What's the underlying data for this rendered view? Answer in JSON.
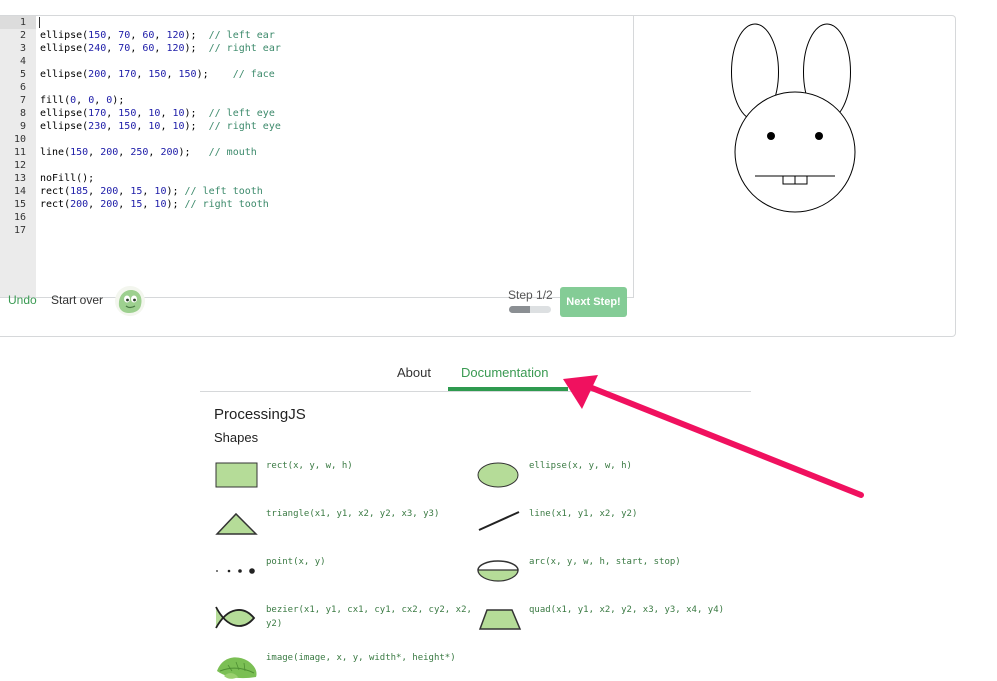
{
  "editor": {
    "line_numbers": [
      "1",
      "2",
      "3",
      "4",
      "5",
      "6",
      "7",
      "8",
      "9",
      "10",
      "11",
      "12",
      "13",
      "14",
      "15",
      "16",
      "17"
    ],
    "code_lines": [
      [],
      [
        {
          "t": "ellipse(",
          "c": ""
        },
        {
          "t": "150",
          "c": "num"
        },
        {
          "t": ", ",
          "c": ""
        },
        {
          "t": "70",
          "c": "num"
        },
        {
          "t": ", ",
          "c": ""
        },
        {
          "t": "60",
          "c": "num"
        },
        {
          "t": ", ",
          "c": ""
        },
        {
          "t": "120",
          "c": "num"
        },
        {
          "t": ");  ",
          "c": ""
        },
        {
          "t": "// left ear",
          "c": "cmt"
        }
      ],
      [
        {
          "t": "ellipse(",
          "c": ""
        },
        {
          "t": "240",
          "c": "num"
        },
        {
          "t": ", ",
          "c": ""
        },
        {
          "t": "70",
          "c": "num"
        },
        {
          "t": ", ",
          "c": ""
        },
        {
          "t": "60",
          "c": "num"
        },
        {
          "t": ", ",
          "c": ""
        },
        {
          "t": "120",
          "c": "num"
        },
        {
          "t": ");  ",
          "c": ""
        },
        {
          "t": "// right ear",
          "c": "cmt"
        }
      ],
      [],
      [
        {
          "t": "ellipse(",
          "c": ""
        },
        {
          "t": "200",
          "c": "num"
        },
        {
          "t": ", ",
          "c": ""
        },
        {
          "t": "170",
          "c": "num"
        },
        {
          "t": ", ",
          "c": ""
        },
        {
          "t": "150",
          "c": "num"
        },
        {
          "t": ", ",
          "c": ""
        },
        {
          "t": "150",
          "c": "num"
        },
        {
          "t": ");    ",
          "c": ""
        },
        {
          "t": "// face",
          "c": "cmt"
        }
      ],
      [],
      [
        {
          "t": "fill(",
          "c": ""
        },
        {
          "t": "0",
          "c": "num"
        },
        {
          "t": ", ",
          "c": ""
        },
        {
          "t": "0",
          "c": "num"
        },
        {
          "t": ", ",
          "c": ""
        },
        {
          "t": "0",
          "c": "num"
        },
        {
          "t": ");",
          "c": ""
        }
      ],
      [
        {
          "t": "ellipse(",
          "c": ""
        },
        {
          "t": "170",
          "c": "num"
        },
        {
          "t": ", ",
          "c": ""
        },
        {
          "t": "150",
          "c": "num"
        },
        {
          "t": ", ",
          "c": ""
        },
        {
          "t": "10",
          "c": "num"
        },
        {
          "t": ", ",
          "c": ""
        },
        {
          "t": "10",
          "c": "num"
        },
        {
          "t": ");  ",
          "c": ""
        },
        {
          "t": "// left eye",
          "c": "cmt"
        }
      ],
      [
        {
          "t": "ellipse(",
          "c": ""
        },
        {
          "t": "230",
          "c": "num"
        },
        {
          "t": ", ",
          "c": ""
        },
        {
          "t": "150",
          "c": "num"
        },
        {
          "t": ", ",
          "c": ""
        },
        {
          "t": "10",
          "c": "num"
        },
        {
          "t": ", ",
          "c": ""
        },
        {
          "t": "10",
          "c": "num"
        },
        {
          "t": ");  ",
          "c": ""
        },
        {
          "t": "// right eye",
          "c": "cmt"
        }
      ],
      [],
      [
        {
          "t": "line(",
          "c": ""
        },
        {
          "t": "150",
          "c": "num"
        },
        {
          "t": ", ",
          "c": ""
        },
        {
          "t": "200",
          "c": "num"
        },
        {
          "t": ", ",
          "c": ""
        },
        {
          "t": "250",
          "c": "num"
        },
        {
          "t": ", ",
          "c": ""
        },
        {
          "t": "200",
          "c": "num"
        },
        {
          "t": ");   ",
          "c": ""
        },
        {
          "t": "// mouth",
          "c": "cmt"
        }
      ],
      [],
      [
        {
          "t": "noFill();",
          "c": ""
        }
      ],
      [
        {
          "t": "rect(",
          "c": ""
        },
        {
          "t": "185",
          "c": "num"
        },
        {
          "t": ", ",
          "c": ""
        },
        {
          "t": "200",
          "c": "num"
        },
        {
          "t": ", ",
          "c": ""
        },
        {
          "t": "15",
          "c": "num"
        },
        {
          "t": ", ",
          "c": ""
        },
        {
          "t": "10",
          "c": "num"
        },
        {
          "t": "); ",
          "c": ""
        },
        {
          "t": "// left tooth",
          "c": "cmt"
        }
      ],
      [
        {
          "t": "rect(",
          "c": ""
        },
        {
          "t": "200",
          "c": "num"
        },
        {
          "t": ", ",
          "c": ""
        },
        {
          "t": "200",
          "c": "num"
        },
        {
          "t": ", ",
          "c": ""
        },
        {
          "t": "15",
          "c": "num"
        },
        {
          "t": ", ",
          "c": ""
        },
        {
          "t": "10",
          "c": "num"
        },
        {
          "t": "); ",
          "c": ""
        },
        {
          "t": "// right tooth",
          "c": "cmt"
        }
      ],
      [],
      []
    ]
  },
  "toolbar": {
    "undo_label": "Undo",
    "start_over_label": "Start over",
    "step_label": "Step 1/2",
    "step_progress": 0.5,
    "next_label": "Next Step!"
  },
  "tabs": {
    "about": "About",
    "documentation": "Documentation"
  },
  "docs": {
    "title": "ProcessingJS",
    "section": "Shapes",
    "functions": {
      "rect": "rect(x, y, w, h)",
      "ellipse": "ellipse(x, y, w, h)",
      "triangle": "triangle(x1, y1, x2, y2, x3, y3)",
      "line": "line(x1, y1, x2, y2)",
      "point": "point(x, y)",
      "arc": "arc(x, y, w, h, start, stop)",
      "bezier_1": "bezier(x1, y1, cx1, cy1, cx2, cy2, x2,",
      "bezier_2": "y2)",
      "quad": "quad(x1, y1, x2, y2, x3, y3, x4, y4)",
      "image": "image(image, x, y, width*, height*)"
    }
  },
  "colors": {
    "accent": "#2e9a4f",
    "shape_fill": "#b5dc98",
    "annotation_arrow": "#f0115f"
  }
}
